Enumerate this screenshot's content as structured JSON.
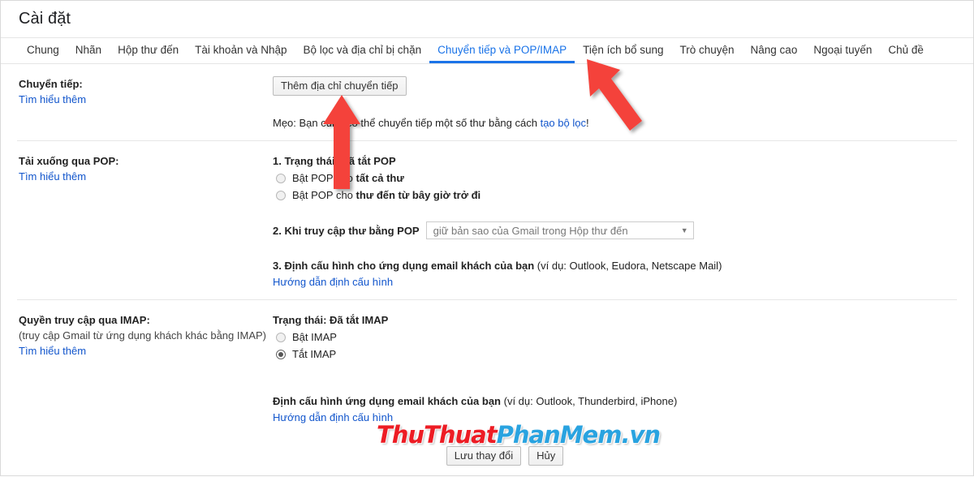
{
  "header": {
    "title": "Cài đặt"
  },
  "tabs": [
    {
      "label": "Chung",
      "active": false
    },
    {
      "label": "Nhãn",
      "active": false
    },
    {
      "label": "Hộp thư đến",
      "active": false
    },
    {
      "label": "Tài khoản và Nhập",
      "active": false
    },
    {
      "label": "Bộ lọc và địa chỉ bị chặn",
      "active": false
    },
    {
      "label": "Chuyển tiếp và POP/IMAP",
      "active": true
    },
    {
      "label": "Tiện ích bổ sung",
      "active": false
    },
    {
      "label": "Trò chuyện",
      "active": false
    },
    {
      "label": "Nâng cao",
      "active": false
    },
    {
      "label": "Ngoại tuyến",
      "active": false
    },
    {
      "label": "Chủ đề",
      "active": false
    }
  ],
  "forwarding": {
    "label": "Chuyển tiếp:",
    "learn_more": "Tìm hiểu thêm",
    "add_button": "Thêm địa chỉ chuyển tiếp",
    "tip_prefix": "Mẹo: Bạn cũng có thể chuyển tiếp một số thư bằng cách ",
    "tip_link": "tạo bộ lọc",
    "tip_suffix": "!"
  },
  "pop": {
    "label": "Tải xuống qua POP:",
    "learn_more": "Tìm hiểu thêm",
    "status_num": "1. Trạng thái:",
    "status_value": "Đã tắt POP",
    "option1_prefix": "Bật POP cho ",
    "option1_bold": "tất cả thư",
    "option1_checked": false,
    "option2_prefix": "Bật POP cho ",
    "option2_bold": "thư đến từ bây giờ trở đi",
    "option2_checked": false,
    "step2_label": "2. Khi truy cập thư bằng POP",
    "step2_select_value": "giữ bản sao của Gmail trong Hộp thư đến",
    "step3_bold": "3. Định cấu hình cho ứng dụng email khách của bạn",
    "step3_note": " (ví dụ: Outlook, Eudora, Netscape Mail)",
    "step3_link": "Hướng dẫn định cấu hình"
  },
  "imap": {
    "label": "Quyền truy cập qua IMAP:",
    "sublabel": "(truy cập Gmail từ ứng dụng khách khác bằng IMAP)",
    "learn_more": "Tìm hiểu thêm",
    "status": "Trạng thái: Đã tắt IMAP",
    "option_on": "Bật IMAP",
    "option_on_checked": false,
    "option_off": "Tắt IMAP",
    "option_off_checked": true,
    "config_bold": "Định cấu hình ứng dụng email khách của bạn",
    "config_note": " (ví dụ: Outlook, Thunderbird, iPhone)",
    "config_link": "Hướng dẫn định cấu hình"
  },
  "footer": {
    "save_label": "Lưu thay đổi",
    "cancel_label": "Hủy"
  },
  "watermark": {
    "part_red": "ThuThuat",
    "part_blue": "PhanMem.vn"
  },
  "annotations": {
    "arrow_color": "#f4433a",
    "arrow_up_name": "red-arrow-up",
    "arrow_diagonal_name": "red-arrow-diagonal"
  },
  "colors": {
    "accent": "#1a73e8",
    "link": "#1155cc",
    "arrow": "#f4433a",
    "watermark_red": "#ed1c24",
    "watermark_blue": "#29a3e0"
  }
}
